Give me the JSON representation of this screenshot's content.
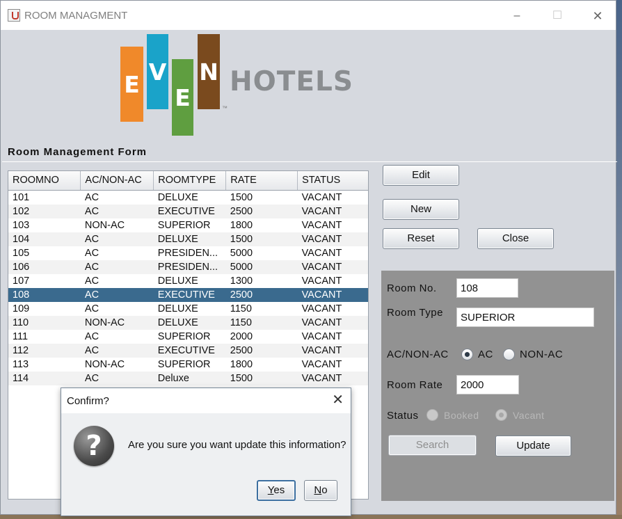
{
  "window": {
    "title": "ROOM MANAGMENT",
    "controls": {
      "minimize": "–",
      "maximize": "☐",
      "close": "✕"
    }
  },
  "logo": {
    "letters": [
      "E",
      "V",
      "E",
      "N"
    ],
    "word": "HOTELS",
    "tm": "™",
    "colors": [
      "#f0892a",
      "#1aa3c9",
      "#5f9e40",
      "#7a4a1e"
    ]
  },
  "form": {
    "title": "Room Management Form"
  },
  "table": {
    "columns": [
      "ROOMNO",
      "AC/NON-AC",
      "ROOMTYPE",
      "RATE",
      "STATUS"
    ],
    "rows": [
      [
        "101",
        "AC",
        "DELUXE",
        "1500",
        "VACANT"
      ],
      [
        "102",
        "AC",
        "EXECUTIVE",
        "2500",
        "VACANT"
      ],
      [
        "103",
        "NON-AC",
        "SUPERIOR",
        "1800",
        "VACANT"
      ],
      [
        "104",
        "AC",
        "DELUXE",
        "1500",
        "VACANT"
      ],
      [
        "105",
        "AC",
        "PRESIDEN...",
        "5000",
        "VACANT"
      ],
      [
        "106",
        "AC",
        "PRESIDEN...",
        "5000",
        "VACANT"
      ],
      [
        "107",
        "AC",
        "DELUXE",
        "1300",
        "VACANT"
      ],
      [
        "108",
        "AC",
        "EXECUTIVE",
        "2500",
        "VACANT"
      ],
      [
        "109",
        "AC",
        "DELUXE",
        "1150",
        "VACANT"
      ],
      [
        "110",
        "NON-AC",
        "DELUXE",
        "1150",
        "VACANT"
      ],
      [
        "111",
        "AC",
        "SUPERIOR",
        "2000",
        "VACANT"
      ],
      [
        "112",
        "AC",
        "EXECUTIVE",
        "2500",
        "VACANT"
      ],
      [
        "113",
        "NON-AC",
        "SUPERIOR",
        "1800",
        "VACANT"
      ],
      [
        "114",
        "AC",
        "Deluxe",
        "1500",
        "VACANT"
      ]
    ],
    "selected_row": 7
  },
  "buttons": {
    "edit": "Edit",
    "new": "New",
    "reset": "Reset",
    "close": "Close"
  },
  "details": {
    "room_no_label": "Room No.",
    "room_no_value": "108",
    "room_type_label": "Room Type",
    "room_type_value": "SUPERIOR",
    "ac_label": "AC/NON-AC",
    "ac_option": "AC",
    "nonac_option": "NON-AC",
    "ac_selected": "AC",
    "rate_label": "Room Rate",
    "rate_value": "2000",
    "status_label": "Status",
    "booked_option": "Booked",
    "vacant_option": "Vacant",
    "status_selected": "Vacant",
    "search_label": "Search",
    "update_label": "Update"
  },
  "dialog": {
    "title": "Confirm?",
    "close": "✕",
    "icon": "question-icon",
    "message": "Are you sure you want update this information?",
    "yes_mnemonic": "Y",
    "yes_rest": "es",
    "no_mnemonic": "N",
    "no_rest": "o"
  }
}
